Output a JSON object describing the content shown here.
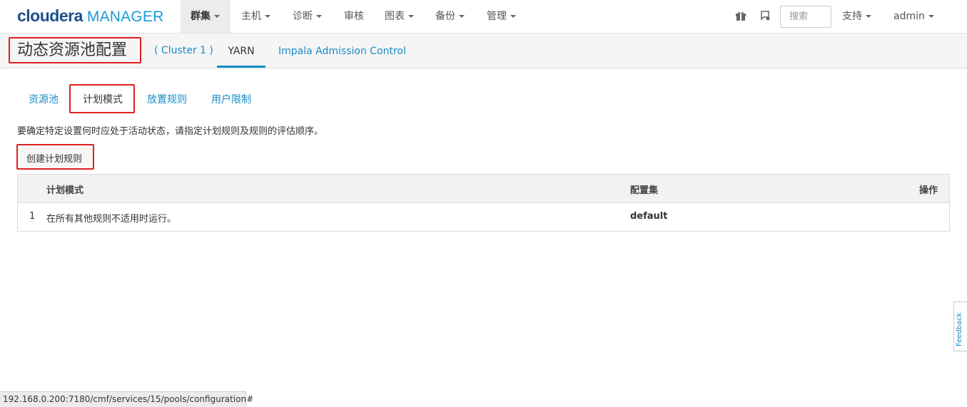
{
  "brand": {
    "name_bold": "cloudera",
    "name_light": "MANAGER"
  },
  "topnav": {
    "items": [
      {
        "label": "群集",
        "dropdown": true,
        "active": true
      },
      {
        "label": "主机",
        "dropdown": true
      },
      {
        "label": "诊断",
        "dropdown": true
      },
      {
        "label": "审核",
        "dropdown": false
      },
      {
        "label": "图表",
        "dropdown": true
      },
      {
        "label": "备份",
        "dropdown": true
      },
      {
        "label": "管理",
        "dropdown": true
      }
    ],
    "icons": [
      "gift-icon",
      "notification-icon"
    ],
    "search_placeholder": "搜索",
    "support_label": "支持",
    "user_label": "admin"
  },
  "subheader": {
    "title": "动态资源池配置",
    "cluster": "( Cluster 1 )",
    "tabs": [
      {
        "label": "YARN",
        "active": true
      },
      {
        "label": "Impala Admission Control",
        "active": false
      }
    ]
  },
  "inner_tabs": {
    "items": [
      "资源池",
      "计划模式",
      "放置规则",
      "用户限制"
    ],
    "active": "计划模式"
  },
  "description": "要确定特定设置何时应处于活动状态，请指定计划规则及规则的评估顺序。",
  "create_button": "创建计划规则",
  "table": {
    "headers": {
      "schedule": "计划模式",
      "config_set": "配置集",
      "actions": "操作"
    },
    "rows": [
      {
        "index": "1",
        "schedule": "在所有其他规则不适用时运行。",
        "config_set": "default"
      }
    ]
  },
  "feedback_label": "Feedback",
  "status_url": "192.168.0.200:7180/cmf/services/15/pools/configuration#",
  "colors": {
    "link": "#1a8cc8",
    "highlight": "#e02020",
    "brand_dark": "#1c4f8a",
    "brand_light": "#1a9ad8"
  }
}
